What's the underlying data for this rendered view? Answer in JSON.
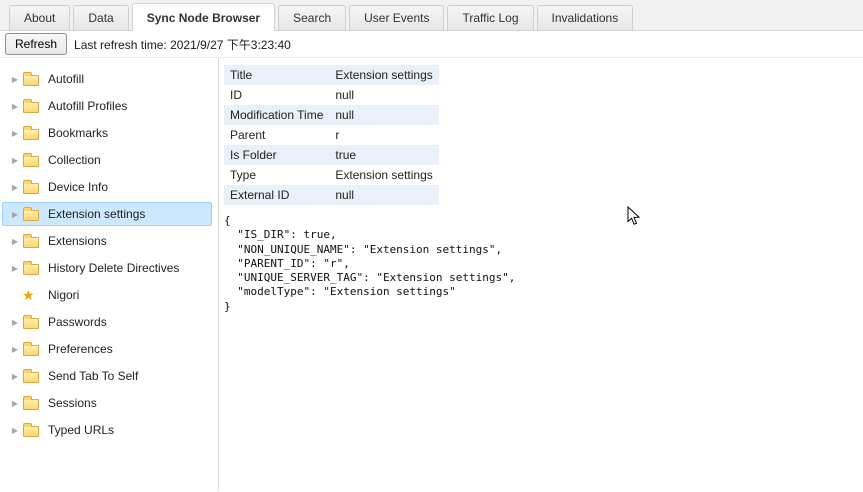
{
  "tabs": [
    {
      "label": "About",
      "active": false
    },
    {
      "label": "Data",
      "active": false
    },
    {
      "label": "Sync Node Browser",
      "active": true
    },
    {
      "label": "Search",
      "active": false
    },
    {
      "label": "User Events",
      "active": false
    },
    {
      "label": "Traffic Log",
      "active": false
    },
    {
      "label": "Invalidations",
      "active": false
    }
  ],
  "toolbar": {
    "refresh_label": "Refresh",
    "last_refresh": "Last refresh time: 2021/9/27 下午3:23:40"
  },
  "tree": {
    "items": [
      {
        "label": "Autofill",
        "icon": "folder",
        "expandable": true,
        "selected": false
      },
      {
        "label": "Autofill Profiles",
        "icon": "folder",
        "expandable": true,
        "selected": false
      },
      {
        "label": "Bookmarks",
        "icon": "folder",
        "expandable": true,
        "selected": false
      },
      {
        "label": "Collection",
        "icon": "folder",
        "expandable": true,
        "selected": false
      },
      {
        "label": "Device Info",
        "icon": "folder",
        "expandable": true,
        "selected": false
      },
      {
        "label": "Extension settings",
        "icon": "folder",
        "expandable": true,
        "selected": true
      },
      {
        "label": "Extensions",
        "icon": "folder",
        "expandable": true,
        "selected": false
      },
      {
        "label": "History Delete Directives",
        "icon": "folder",
        "expandable": true,
        "selected": false
      },
      {
        "label": "Nigori",
        "icon": "star",
        "expandable": false,
        "selected": false
      },
      {
        "label": "Passwords",
        "icon": "folder",
        "expandable": true,
        "selected": false
      },
      {
        "label": "Preferences",
        "icon": "folder",
        "expandable": true,
        "selected": false
      },
      {
        "label": "Send Tab To Self",
        "icon": "folder",
        "expandable": true,
        "selected": false
      },
      {
        "label": "Sessions",
        "icon": "folder",
        "expandable": true,
        "selected": false
      },
      {
        "label": "Typed URLs",
        "icon": "folder",
        "expandable": true,
        "selected": false
      }
    ]
  },
  "details": {
    "rows": [
      {
        "label": "Title",
        "value": "Extension settings"
      },
      {
        "label": "ID",
        "value": "null"
      },
      {
        "label": "Modification Time",
        "value": "null"
      },
      {
        "label": "Parent",
        "value": "r"
      },
      {
        "label": "Is Folder",
        "value": "true"
      },
      {
        "label": "Type",
        "value": "Extension settings"
      },
      {
        "label": "External ID",
        "value": "null"
      }
    ],
    "json": "{\n  \"IS_DIR\": true,\n  \"NON_UNIQUE_NAME\": \"Extension settings\",\n  \"PARENT_ID\": \"r\",\n  \"UNIQUE_SERVER_TAG\": \"Extension settings\",\n  \"modelType\": \"Extension settings\"\n}"
  },
  "colors": {
    "selection_bg": "#cce8ff",
    "selection_border": "#99d1ff",
    "stripe": "#e9f0fa",
    "folder": "#fbd66f",
    "star": "#f0a30a",
    "tabbar_bg": "#f1f1f1"
  }
}
